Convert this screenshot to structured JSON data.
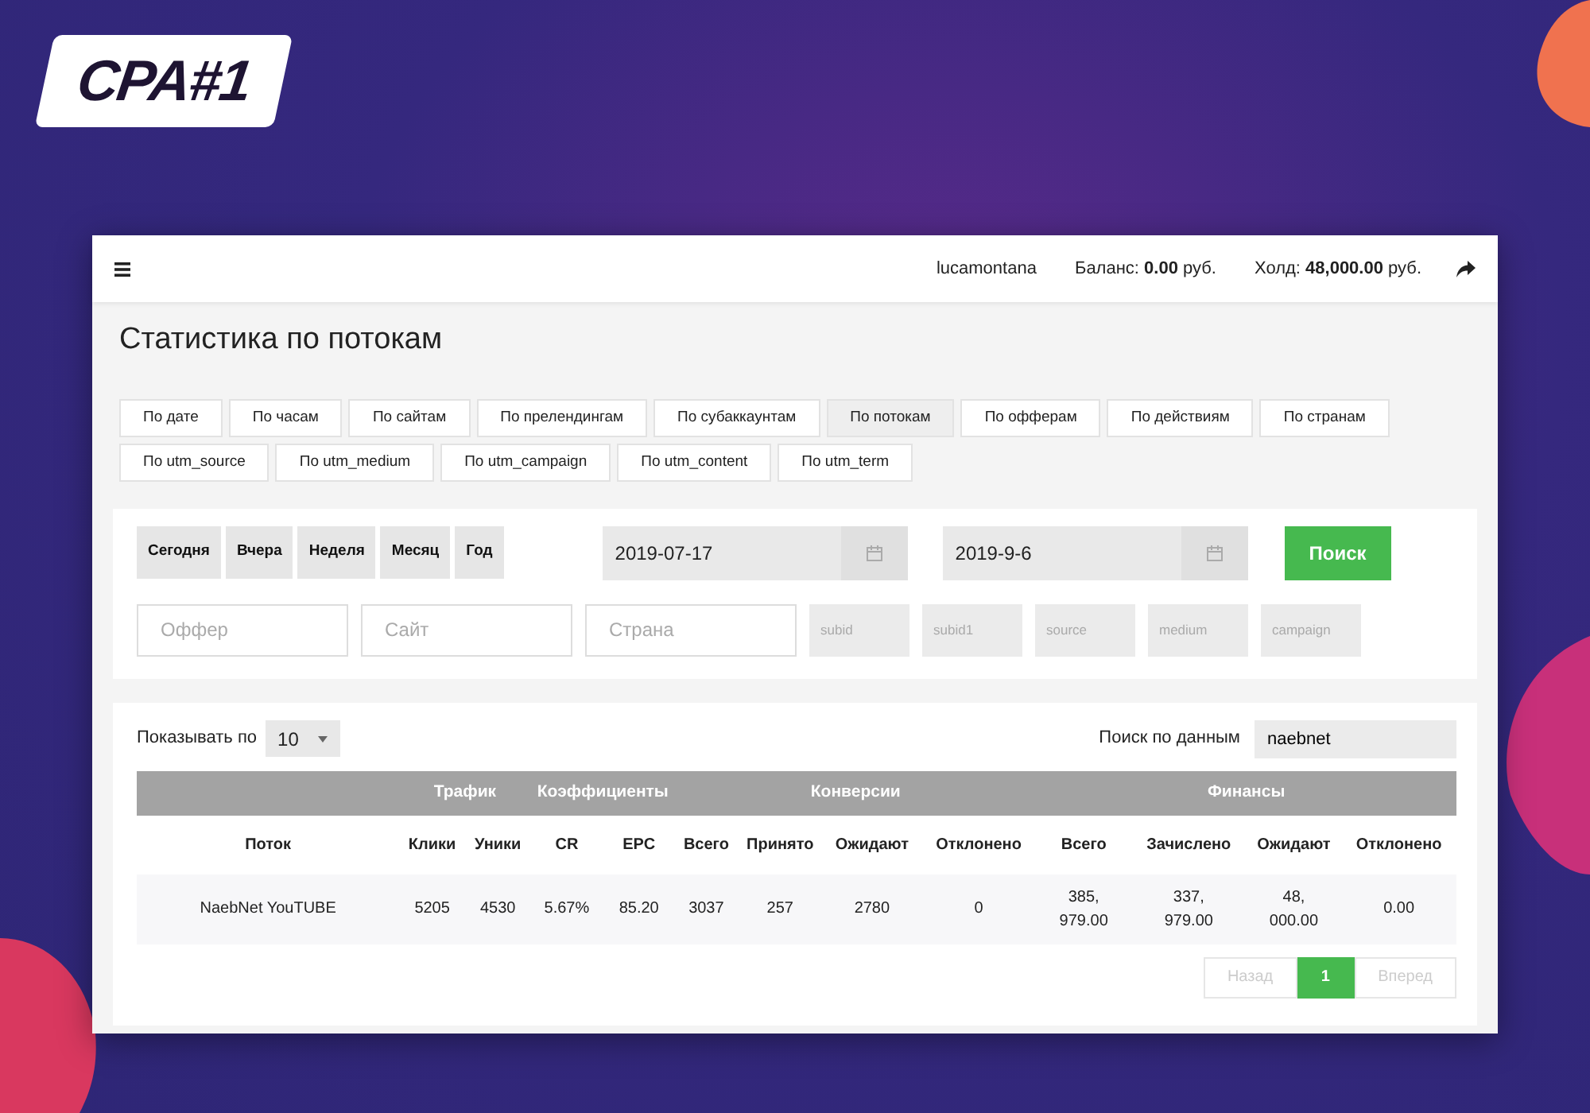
{
  "logo": {
    "text": "CPA#1"
  },
  "navbar": {
    "user": "lucamontana",
    "balance": "Баланс: **0.00** руб.",
    "hold": "Холд: **48,000.00** руб."
  },
  "page_title": "Статистика по потокам",
  "tab_rows": [
    [
      {
        "label": "По дате",
        "selected": false
      },
      {
        "label": "По часам",
        "selected": false
      },
      {
        "label": "По сайтам",
        "selected": false
      },
      {
        "label": "По прелендингам",
        "selected": false
      },
      {
        "label": "По субаккаунтам",
        "selected": false
      },
      {
        "label": "По потокам",
        "selected": true
      },
      {
        "label": "По офферам",
        "selected": false
      },
      {
        "label": "По действиям",
        "selected": false
      },
      {
        "label": "По странам",
        "selected": false
      }
    ],
    [
      {
        "label": "По utm_source",
        "selected": false
      },
      {
        "label": "По utm_medium",
        "selected": false
      },
      {
        "label": "По utm_campaign",
        "selected": false
      },
      {
        "label": "По utm_content",
        "selected": false
      },
      {
        "label": "По utm_term",
        "selected": false
      }
    ]
  ],
  "filters": {
    "periods": [
      "Сегодня",
      "Вчера",
      "Неделя",
      "Месяц",
      "Год"
    ],
    "date_from": "2019-07-17",
    "date_to": "2019-9-6",
    "search_button": "Поиск",
    "fields": [
      {
        "placeholder": "Оффер",
        "kind": "large"
      },
      {
        "placeholder": "Сайт",
        "kind": "large"
      },
      {
        "placeholder": "Страна",
        "kind": "large"
      },
      {
        "placeholder": "subid",
        "kind": "small"
      },
      {
        "placeholder": "subid1",
        "kind": "small"
      },
      {
        "placeholder": "source",
        "kind": "small"
      },
      {
        "placeholder": "medium",
        "kind": "small"
      },
      {
        "placeholder": "campaign",
        "kind": "small"
      }
    ]
  },
  "table_controls": {
    "show_label": "Показывать по",
    "page_size": "10",
    "search_label": "Поиск по данным",
    "search_value": "naebnet"
  },
  "table": {
    "column_groups": [
      {
        "columns": [
          "Поток"
        ]
      },
      {
        "label": "Трафик",
        "columns": [
          "Клики",
          "Уники"
        ]
      },
      {
        "label": "Коэффициенты",
        "columns": [
          "CR",
          "EPC"
        ]
      },
      {
        "label": "Конверсии",
        "columns": [
          "Всего",
          "Принято",
          "Ожидают",
          "Отклонено"
        ]
      },
      {
        "label": "Финансы",
        "columns": [
          "Всего",
          "Зачислено",
          "Ожидают",
          "Отклонено"
        ]
      }
    ],
    "rows": [
      [
        "NaebNet YouTUBE",
        "5205",
        "4530",
        "5.67%",
        "85.20",
        "3037",
        "257",
        "2780",
        "0",
        "385, 979.00",
        "337, 979.00",
        "48, 000.00",
        "0.00"
      ]
    ]
  },
  "pagination": {
    "prev": {
      "label": "Назад",
      "disabled": true
    },
    "pages": [
      {
        "label": "1",
        "selected": true
      }
    ],
    "next": {
      "label": "Вперед",
      "disabled": true
    }
  }
}
